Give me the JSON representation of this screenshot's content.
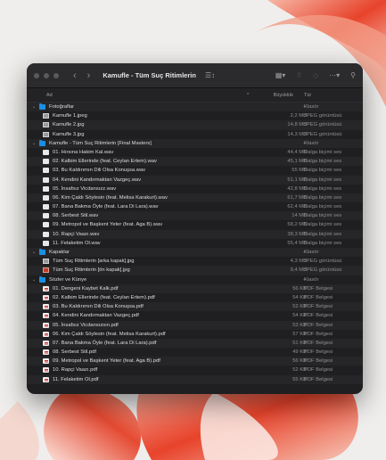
{
  "window": {
    "title": "Kamufle - Tüm Suç Ritimlerin"
  },
  "toolbar": {
    "back_icon": "chevron-left-icon",
    "forward_icon": "chevron-right-icon",
    "view_icon": "list-view-icon",
    "group_icon": "grid-group-icon",
    "share_icon": "share-icon",
    "tag_icon": "tag-icon",
    "more_icon": "ellipsis-circle-icon",
    "search_icon": "search-icon"
  },
  "columns": {
    "name": "Ad",
    "size": "Büyüklük",
    "kind": "Tür"
  },
  "rows": [
    {
      "type": "folder",
      "open": true,
      "level": 0,
      "name": "Fotoğraflar",
      "size": "--",
      "kind": "Klasör"
    },
    {
      "type": "image",
      "level": 1,
      "name": "Kamufle 1.jpeg",
      "size": "2,2 MB",
      "kind": "JPEG görüntüsü"
    },
    {
      "type": "image",
      "level": 1,
      "name": "Kamufle 2.jpg",
      "size": "14,8 MB",
      "kind": "JPEG görüntüsü"
    },
    {
      "type": "image",
      "level": 1,
      "name": "Kamufle 3.jpg",
      "size": "14,3 MB",
      "kind": "JPEG görüntüsü"
    },
    {
      "type": "folder",
      "open": true,
      "level": 0,
      "name": "Kamufle - Tüm Suç Ritimlerin [Final Masters]",
      "size": "--",
      "kind": "Klasör"
    },
    {
      "type": "wav",
      "level": 1,
      "name": "01. Hırsına Hakim Kal.wav",
      "size": "44,4 MB",
      "kind": "Dalga biçimi ses"
    },
    {
      "type": "wav",
      "level": 1,
      "name": "02. Kalbim Ellerinde (feat. Ceylan Ertem).wav",
      "size": "45,1 MB",
      "kind": "Dalga biçimi ses"
    },
    {
      "type": "wav",
      "level": 1,
      "name": "03. Bu Kaldırımın Dili Olsa Konuşsa.wav",
      "size": "55 MB",
      "kind": "Dalga biçimi ses"
    },
    {
      "type": "wav",
      "level": 1,
      "name": "04. Kendini Kandırmaktan Vazgeç.wav",
      "size": "51,1 MB",
      "kind": "Dalga biçimi ses"
    },
    {
      "type": "wav",
      "level": 1,
      "name": "05. İnsafsız Vicdansızz.wav",
      "size": "42,8 MB",
      "kind": "Dalga biçimi ses"
    },
    {
      "type": "wav",
      "level": 1,
      "name": "06. Kim Çaldı Söylesin (feat. Melisa Karakurt).wav",
      "size": "61,7 MB",
      "kind": "Dalga biçimi ses"
    },
    {
      "type": "wav",
      "level": 1,
      "name": "07. Bana Bakma Öyle (feat. Lara Di Lara).wav",
      "size": "62,4 MB",
      "kind": "Dalga biçimi ses"
    },
    {
      "type": "wav",
      "level": 1,
      "name": "08. Serbest Stil.wav",
      "size": "14 MB",
      "kind": "Dalga biçimi ses"
    },
    {
      "type": "wav",
      "level": 1,
      "name": "09. Metropol ve Başkent Yeter (feat. Aga B).wav",
      "size": "58,2 MB",
      "kind": "Dalga biçimi ses"
    },
    {
      "type": "wav",
      "level": 1,
      "name": "10. Rapçi Vaazı.wav",
      "size": "38,3 MB",
      "kind": "Dalga biçimi ses"
    },
    {
      "type": "wav",
      "level": 1,
      "name": "11. Felaketim Ol.wav",
      "size": "55,4 MB",
      "kind": "Dalga biçimi ses"
    },
    {
      "type": "folder",
      "open": true,
      "level": 0,
      "name": "Kapaklar",
      "size": "--",
      "kind": "Klasör"
    },
    {
      "type": "image",
      "level": 1,
      "name": "Tüm Suç Ritimlerin [arka kapak].jpg",
      "size": "4,3 MB",
      "kind": "JPEG görüntüsü"
    },
    {
      "type": "image-red",
      "level": 1,
      "name": "Tüm Suç Ritimlerin [ön kapak].jpg",
      "size": "9,4 MB",
      "kind": "JPEG görüntüsü"
    },
    {
      "type": "folder",
      "open": true,
      "level": 0,
      "name": "Sözler ve Künye",
      "size": "--",
      "kind": "Klasör"
    },
    {
      "type": "pdf",
      "level": 1,
      "name": "01. Dengeni Kaybet Kalk.pdf",
      "size": "56 KB",
      "kind": "PDF Belgesi"
    },
    {
      "type": "pdf",
      "level": 1,
      "name": "02. Kalbim Ellerinde (feat. Ceylan Ertem).pdf",
      "size": "54 KB",
      "kind": "PDF Belgesi"
    },
    {
      "type": "pdf",
      "level": 1,
      "name": "03. Bu Kaldırımın Dili Olsa Konuşsa.pdf",
      "size": "52 KB",
      "kind": "PDF Belgesi"
    },
    {
      "type": "pdf",
      "level": 1,
      "name": "04. Kendini Kandırmaktan Vazgeç.pdf",
      "size": "54 KB",
      "kind": "PDF Belgesi"
    },
    {
      "type": "pdf",
      "level": 1,
      "name": "05. İnsafsız Vicdansızsın.pdf",
      "size": "53 KB",
      "kind": "PDF Belgesi"
    },
    {
      "type": "pdf",
      "level": 1,
      "name": "06. Kim Çaldı Söylesin (feat. Melisa Karakurt).pdf",
      "size": "57 KB",
      "kind": "PDF Belgesi"
    },
    {
      "type": "pdf",
      "level": 1,
      "name": "07. Bana Bakma Öyle (feat. Lara Di Lara).pdf",
      "size": "51 KB",
      "kind": "PDF Belgesi"
    },
    {
      "type": "pdf",
      "level": 1,
      "name": "08. Serbest Stil.pdf",
      "size": "49 KB",
      "kind": "PDF Belgesi"
    },
    {
      "type": "pdf",
      "level": 1,
      "name": "09. Metropol ve Başkent Yeter (feat. Aga B).pdf",
      "size": "56 KB",
      "kind": "PDF Belgesi"
    },
    {
      "type": "pdf",
      "level": 1,
      "name": "10. Rapçi Vaazı.pdf",
      "size": "52 KB",
      "kind": "PDF Belgesi"
    },
    {
      "type": "pdf",
      "level": 1,
      "name": "11. Felaketim Ol.pdf",
      "size": "55 KB",
      "kind": "PDF Belgesi"
    }
  ]
}
